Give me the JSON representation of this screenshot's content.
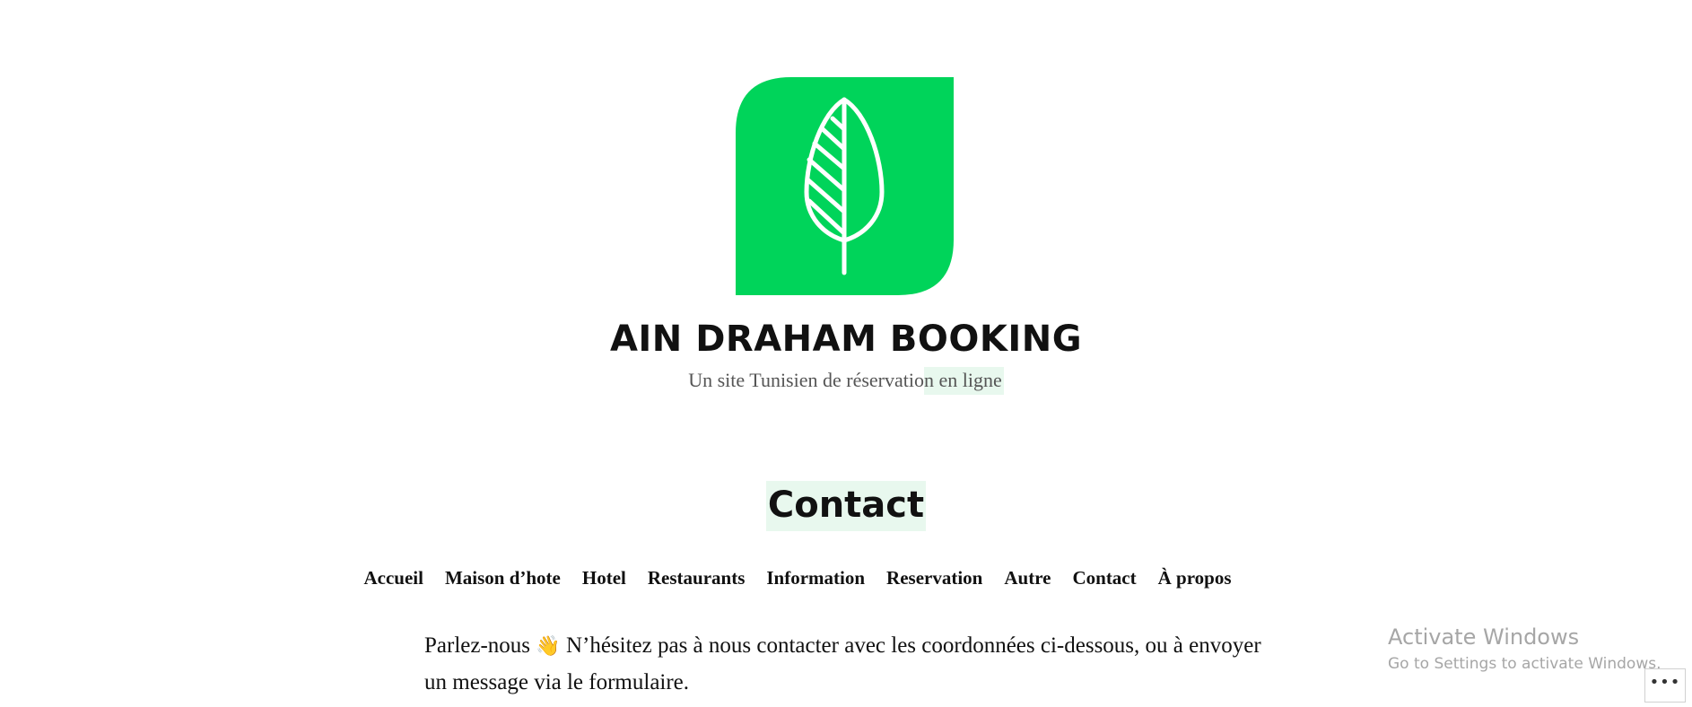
{
  "site": {
    "title": "AIN DRAHAM BOOKING",
    "tagline_start": "Un site Tunisien de réservatio",
    "tagline_highlight": "n en ligne",
    "logo_icon": "leaf-logo-icon",
    "logo_color": "#00d45a"
  },
  "page": {
    "title": "Contact"
  },
  "nav": {
    "items": [
      {
        "label": "Accueil"
      },
      {
        "label": "Maison d’hote"
      },
      {
        "label": "Hotel"
      },
      {
        "label": "Restaurants"
      },
      {
        "label": "Information"
      },
      {
        "label": "Reservation"
      },
      {
        "label": "Autre"
      },
      {
        "label": "Contact"
      },
      {
        "label": "À propos"
      }
    ]
  },
  "content": {
    "intro_before": "Parlez-nous",
    "wave_emoji": "👋",
    "intro_after": "N’hésitez pas à nous contacter avec les coordonnées ci-dessous, ou à envoyer un message via le formulaire."
  },
  "watermark": {
    "title": "Activate Windows",
    "subtitle": "Go to Settings to activate Windows."
  },
  "more_button": {
    "label": "•••",
    "icon": "more-options-icon"
  }
}
